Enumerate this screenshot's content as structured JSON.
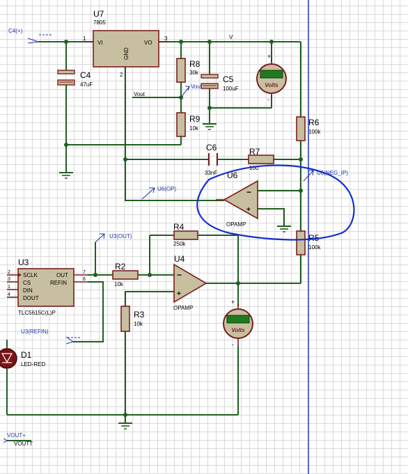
{
  "components": {
    "u7": {
      "ref": "U7",
      "part": "7805",
      "pin_in": "VI",
      "pin_out": "VO",
      "pin_gnd": "GND",
      "n1": "1",
      "n2": "2",
      "n3": "3"
    },
    "c4": {
      "ref": "C4",
      "value": "47uF"
    },
    "c5": {
      "ref": "C5",
      "value": "100uF"
    },
    "c6": {
      "ref": "C6",
      "value": "33nF"
    },
    "r8": {
      "ref": "R8",
      "value": "30k"
    },
    "r9": {
      "ref": "R9",
      "value": "10k"
    },
    "r6": {
      "ref": "R6",
      "value": "100k"
    },
    "r7": {
      "ref": "R7",
      "value": "100"
    },
    "r5": {
      "ref": "R5",
      "value": "100k"
    },
    "r4": {
      "ref": "R4",
      "value": "250k"
    },
    "r2": {
      "ref": "R2",
      "value": "10k"
    },
    "r3": {
      "ref": "R3",
      "value": "10k"
    },
    "u6": {
      "ref": "U6",
      "part": "OPAMP"
    },
    "u4": {
      "ref": "U4",
      "part": "OPAMP"
    },
    "u3": {
      "ref": "U3",
      "part": "TLC5615C(L)P",
      "pins": [
        "SCLK",
        "CS",
        "DIN",
        "DOUT"
      ],
      "pin_nums": [
        "2",
        "3",
        "1",
        "4"
      ],
      "out": "OUT",
      "refin": "REFIN",
      "out_num": "7",
      "refin_num": "6"
    },
    "d1": {
      "ref": "D1",
      "part": "LED-RED"
    }
  },
  "voltmeters": [
    {
      "unit": "Volts",
      "plus": "+",
      "minus": "-"
    },
    {
      "unit": "Volts",
      "plus": "+",
      "minus": "-"
    }
  ],
  "terminals": {
    "c4_plus": "C4(+)",
    "vout_net": "Vout",
    "vout_arrow": "Vout",
    "v_net": "V",
    "u6_op": "U6(OP)",
    "u6_neg": "U6(NEG_IP)",
    "u3_out": "U3(OUT)",
    "u3_refin": "U3(REFIN)",
    "vout_plus": "VOUT+",
    "voutt": "VOUTT"
  },
  "colors": {
    "wire": "#1f5f1f",
    "body": "#c8bfa0",
    "outline": "#7a1e1e",
    "terminal_text": "#1f2fa8",
    "annotation": "#1030d0",
    "cursor_line": "#1a2db0",
    "meter_display": "#1f7a1f"
  }
}
